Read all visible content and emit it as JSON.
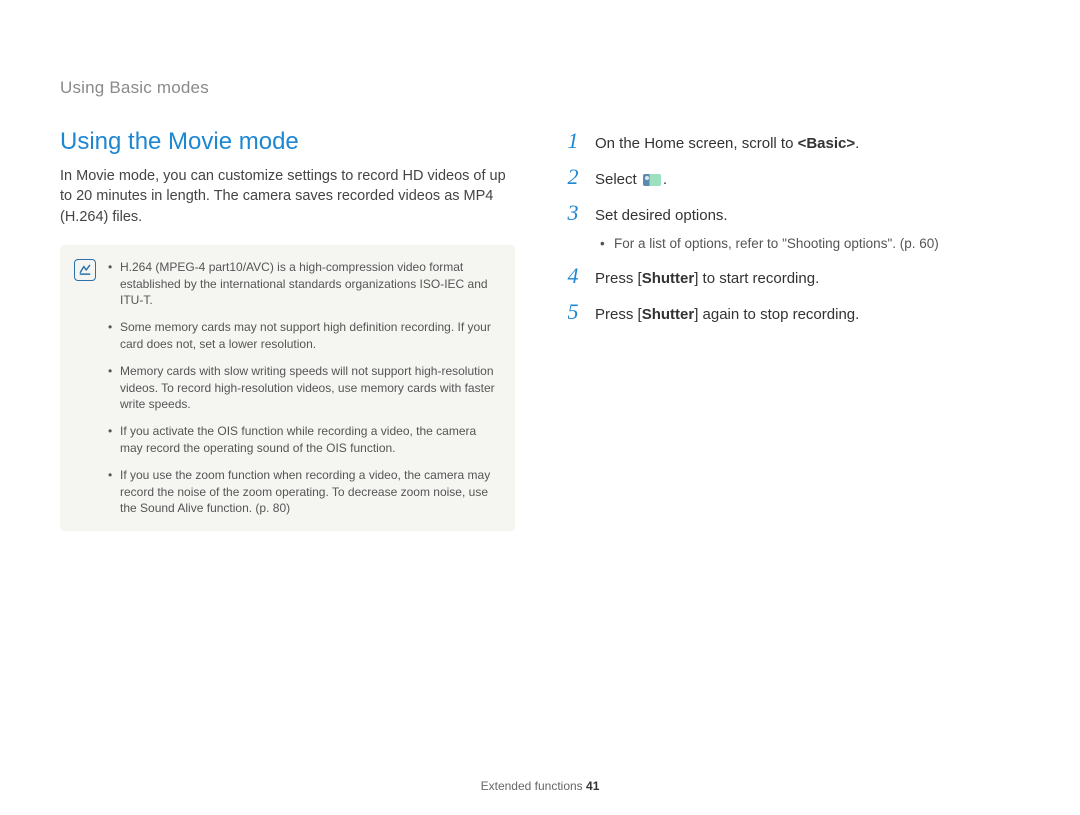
{
  "breadcrumb": "Using Basic modes",
  "section_title": "Using the Movie mode",
  "intro": "In Movie mode, you can customize settings to record HD videos of up to 20 minutes in length. The camera saves recorded videos as MP4 (H.264) files.",
  "notes": [
    "H.264 (MPEG-4 part10/AVC) is a high-compression video format established by the international standards organizations ISO-IEC and ITU-T.",
    "Some memory cards may not support high definition recording. If your card does not, set a lower resolution.",
    "Memory cards with slow writing speeds will not support high-resolution videos. To record high-resolution videos, use memory cards with faster write speeds.",
    "If you activate the OIS function while recording a video, the camera may record the operating sound of the OIS function.",
    "If you use the zoom function when recording a video, the camera may record the noise of the zoom operating. To decrease zoom noise, use the Sound Alive function. (p. 80)"
  ],
  "steps": {
    "s1_pre": "On the Home screen, scroll to ",
    "s1_bold": "<Basic>",
    "s1_post": ".",
    "s2_pre": "Select ",
    "s2_post": ".",
    "s3": "Set desired options.",
    "s3_sub": "For a list of options, refer to \"Shooting options\". (p. 60)",
    "s4_pre": "Press [",
    "s4_bold": "Shutter",
    "s4_post": "] to start recording.",
    "s5_pre": "Press [",
    "s5_bold": "Shutter",
    "s5_post": "] again to stop recording."
  },
  "step_numbers": [
    "1",
    "2",
    "3",
    "4",
    "5"
  ],
  "footer_label": "Extended functions  ",
  "footer_page": "41"
}
